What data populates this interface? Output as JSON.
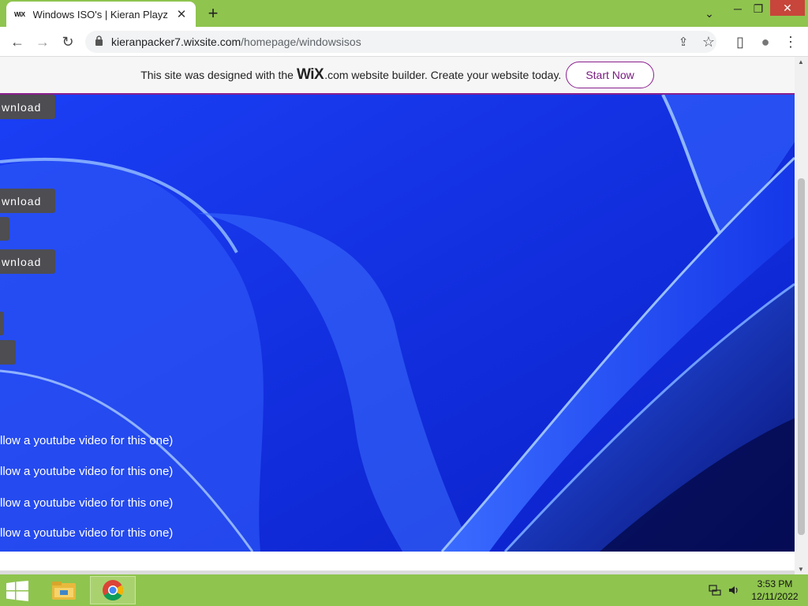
{
  "browser": {
    "tab": {
      "favicon": "WiX",
      "title": "Windows ISO's | Kieran Playz",
      "close": "✕"
    },
    "new_tab": "+",
    "window_controls": {
      "dropdown": "⌄",
      "minimize": "─",
      "restore": "❐",
      "close": "✕"
    },
    "nav": {
      "back": "←",
      "forward": "→",
      "reload": "↻"
    },
    "url": {
      "host": "kieranpacker7.wixsite.com",
      "path": "/homepage/windowsisos"
    },
    "toolbar_icons": {
      "share": "⇪",
      "bookmark": "☆",
      "sidepanel": "▯",
      "profile": "●",
      "menu": "⋮"
    }
  },
  "wix_banner": {
    "text_before": "This site was designed with the",
    "logo": "WiX",
    "text_after": ".com website builder. Create your website today.",
    "button": "Start Now"
  },
  "page": {
    "download_buttons": [
      {
        "label": "wnload"
      },
      {
        "label": "wnload"
      },
      {
        "label": "wnload"
      }
    ],
    "video_notes": [
      "llow a youtube video for this one)",
      "llow a youtube video for this one)",
      "llow a youtube video for this one)",
      "llow a youtube video for this one)"
    ]
  },
  "taskbar": {
    "clock_time": "3:53 PM",
    "clock_date": "12/11/2022"
  },
  "colors": {
    "accent": "#8fc44f",
    "wix_purple": "#8a1f8f",
    "hero_blue": "#1d3cf0"
  }
}
